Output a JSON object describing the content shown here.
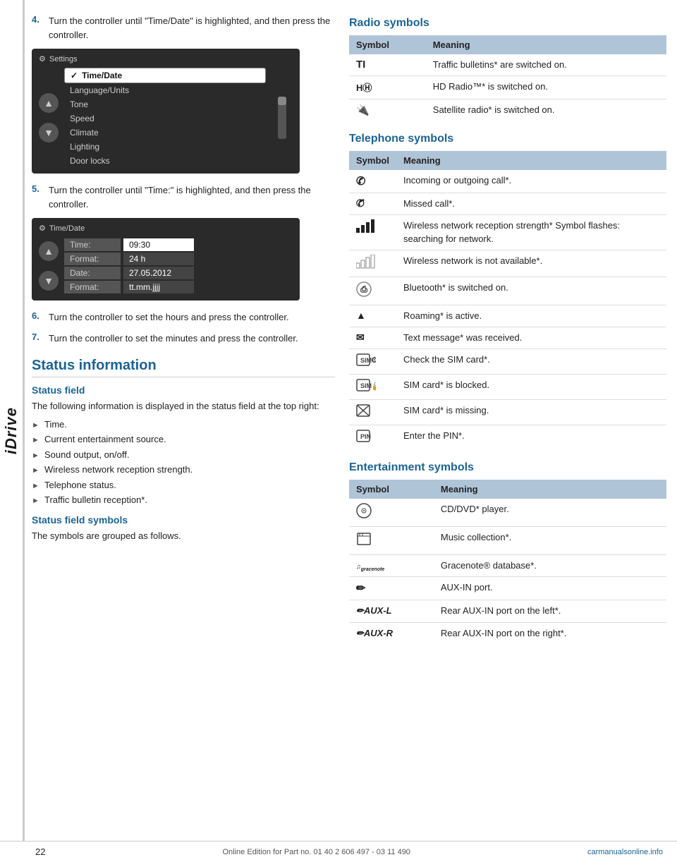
{
  "idrive_label": "iDrive",
  "left_col": {
    "steps": [
      {
        "num": "4.",
        "text": "Turn the controller until \"Time/Date\" is highlighted, and then press the controller."
      },
      {
        "num": "5.",
        "text": "Turn the controller until \"Time:\" is highlighted, and then press the controller."
      },
      {
        "num": "6.",
        "text": "Turn the controller to set the hours and press the controller."
      },
      {
        "num": "7.",
        "text": "Turn the controller to set the minutes and press the controller."
      }
    ],
    "screen1": {
      "title": "Settings",
      "items": [
        {
          "label": "Time/Date",
          "selected": true
        },
        {
          "label": "Language/Units",
          "selected": false
        },
        {
          "label": "Tone",
          "selected": false
        },
        {
          "label": "Speed",
          "selected": false
        },
        {
          "label": "Climate",
          "selected": false
        },
        {
          "label": "Lighting",
          "selected": false
        },
        {
          "label": "Door locks",
          "selected": false
        }
      ]
    },
    "screen2": {
      "title": "Time/Date",
      "rows": [
        {
          "label": "Time:",
          "value": "09:30"
        },
        {
          "label": "Format:",
          "value": "24 h"
        },
        {
          "label": "Date:",
          "value": "27.05.2012"
        },
        {
          "label": "Format:",
          "value": "tt.mm.jjjj"
        }
      ]
    },
    "status_section": {
      "title": "Status information",
      "status_field": {
        "subtitle": "Status field",
        "body": "The following information is displayed in the status field at the top right:",
        "bullets": [
          "Time.",
          "Current entertainment source.",
          "Sound output, on/off.",
          "Wireless network reception strength.",
          "Telephone status.",
          "Traffic bulletin reception*."
        ]
      },
      "status_field_symbols": {
        "subtitle": "Status field symbols",
        "body": "The symbols are grouped as follows."
      }
    }
  },
  "right_col": {
    "radio_section": {
      "title": "Radio symbols",
      "headers": [
        "Symbol",
        "Meaning"
      ],
      "rows": [
        {
          "symbol": "TI",
          "meaning": "Traffic bulletins* are switched on."
        },
        {
          "symbol": "Hⓓ",
          "meaning": "HD Radio™* is switched on."
        },
        {
          "symbol": "★",
          "meaning": "Satellite radio* is switched on."
        }
      ]
    },
    "telephone_section": {
      "title": "Telephone symbols",
      "headers": [
        "Symbol",
        "Meaning"
      ],
      "rows": [
        {
          "symbol": "☎",
          "meaning": "Incoming or outgoing call*."
        },
        {
          "symbol": "↗✗",
          "meaning": "Missed call*."
        },
        {
          "symbol": "▐▐▐",
          "meaning": "Wireless network reception strength* Symbol flashes: searching for network."
        },
        {
          "symbol": "▐▐▐",
          "meaning": "Wireless network is not available*."
        },
        {
          "symbol": "⊛",
          "meaning": "Bluetooth* is switched on."
        },
        {
          "symbol": "▲",
          "meaning": "Roaming* is active."
        },
        {
          "symbol": "✉",
          "meaning": "Text message* was received."
        },
        {
          "symbol": "🖳⚙",
          "meaning": "Check the SIM card*."
        },
        {
          "symbol": "🖳🔒",
          "meaning": "SIM card* is blocked."
        },
        {
          "symbol": "🖳✗",
          "meaning": "SIM card* is missing."
        },
        {
          "symbol": "🖳🔑",
          "meaning": "Enter the PIN*."
        }
      ]
    },
    "entertainment_section": {
      "title": "Entertainment symbols",
      "headers": [
        "Symbol",
        "Meaning"
      ],
      "rows": [
        {
          "symbol": "⊙",
          "meaning": "CD/DVD* player."
        },
        {
          "symbol": "💾",
          "meaning": "Music collection*."
        },
        {
          "symbol": "g gracenote",
          "meaning": "Gracenote® database*."
        },
        {
          "symbol": "✏",
          "meaning": "AUX-IN port."
        },
        {
          "symbol": "✏AUX-L",
          "meaning": "Rear AUX-IN port on the left*."
        },
        {
          "symbol": "✏AUX-R",
          "meaning": "Rear AUX-IN port on the right*."
        }
      ]
    }
  },
  "footer": {
    "page_num": "22",
    "text": "Online Edition for Part no. 01 40 2 606 497 - 03 11 490",
    "watermark": "carmanualsonline.info"
  }
}
